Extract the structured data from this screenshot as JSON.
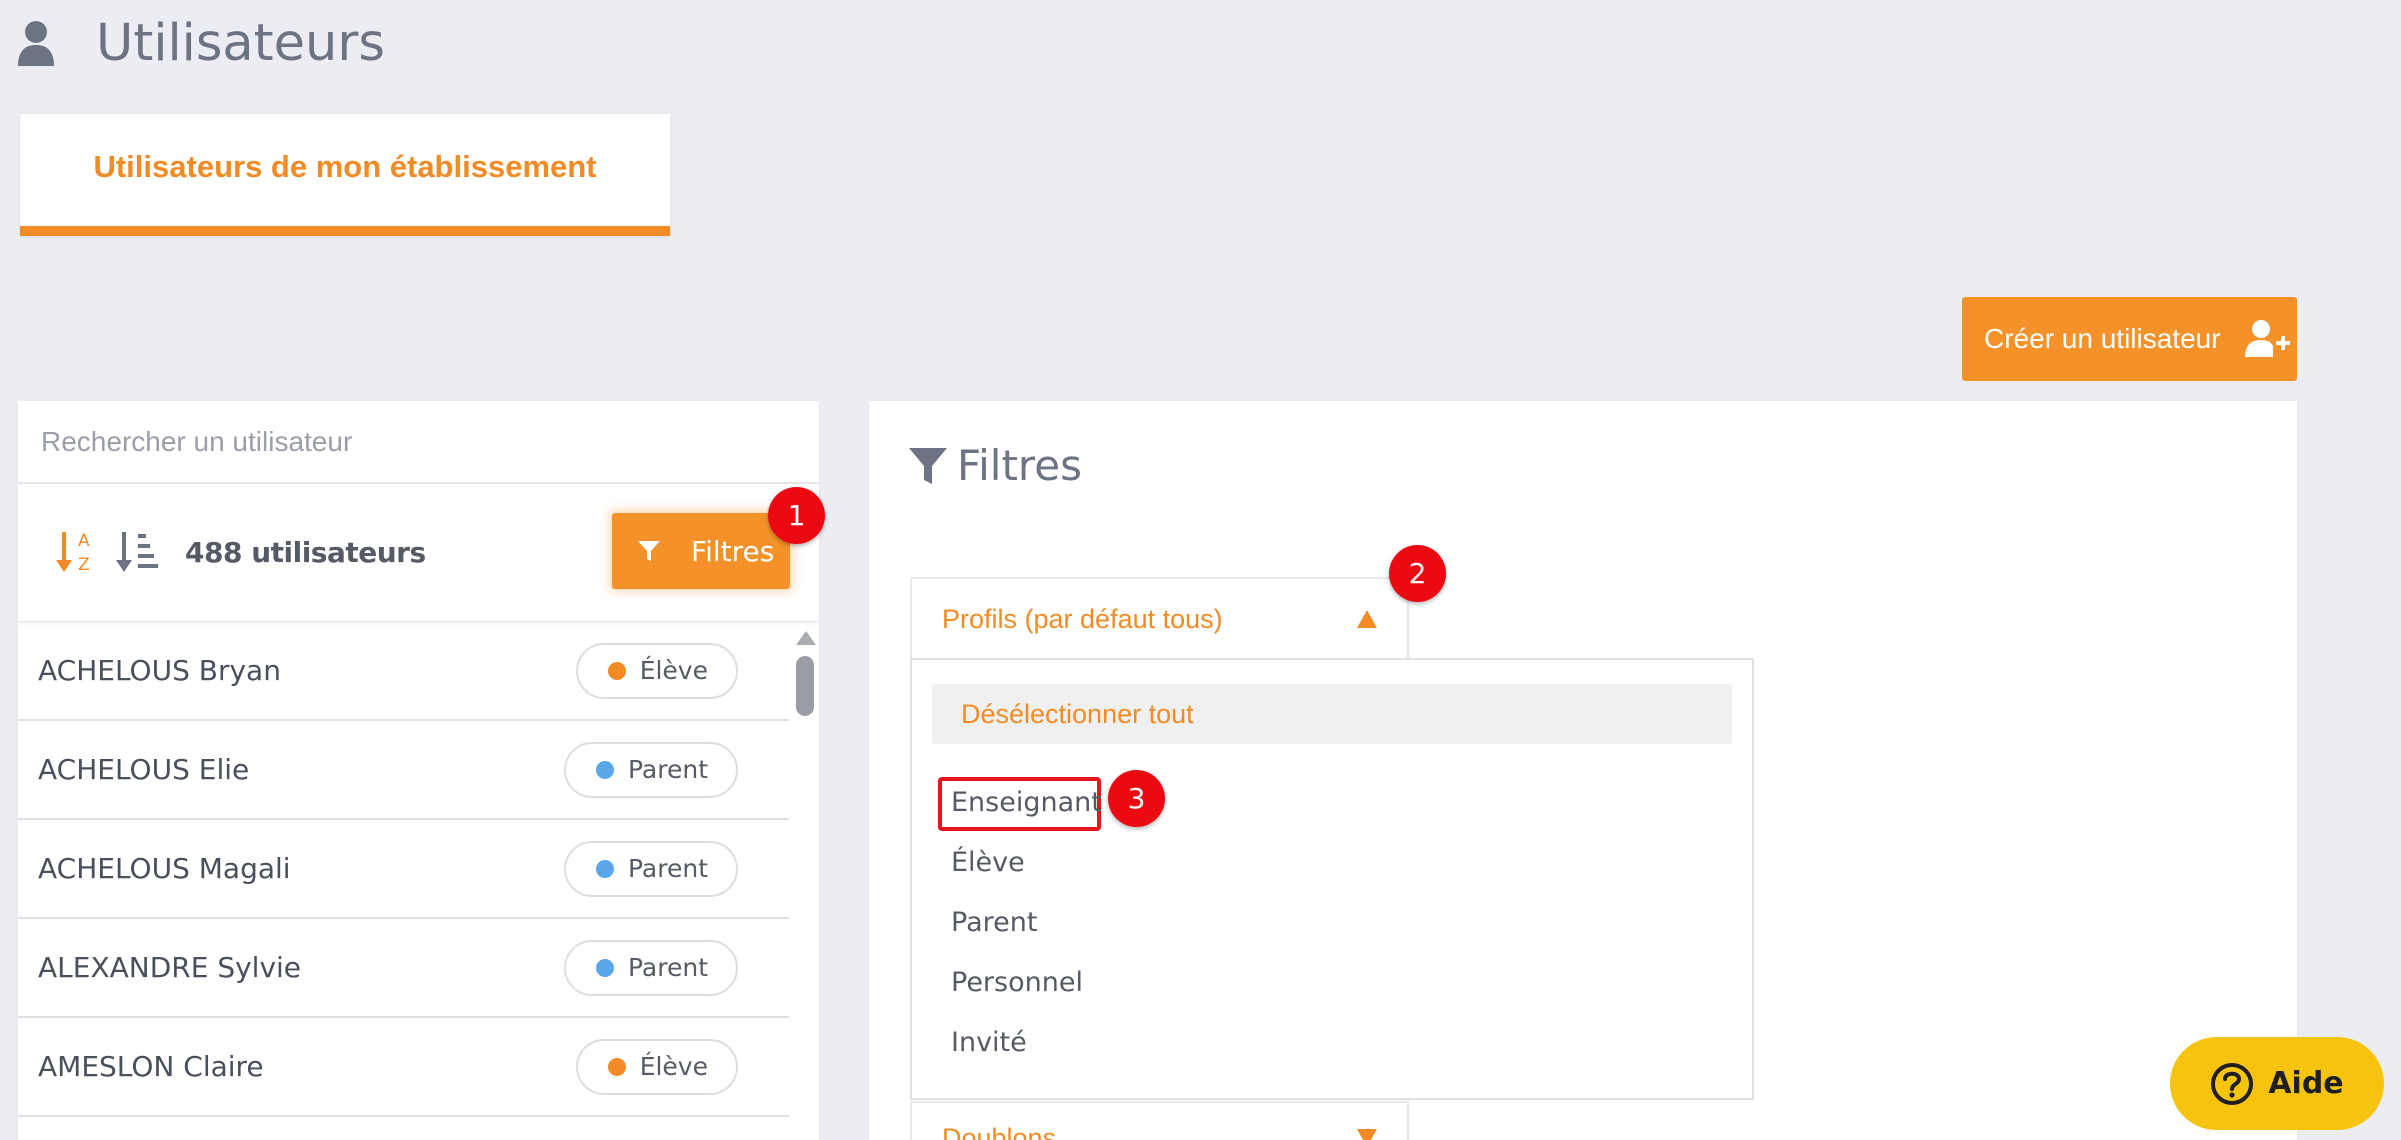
{
  "header": {
    "title": "Utilisateurs",
    "icon": "user-icon"
  },
  "tab": {
    "label": "Utilisateurs de mon établissement"
  },
  "create_button": {
    "label": "Créer un utilisateur",
    "icon": "add-user-icon"
  },
  "search": {
    "placeholder": "Rechercher un utilisateur",
    "value": ""
  },
  "toolbar": {
    "user_count": "488 utilisateurs",
    "filter_label": "Filtres"
  },
  "users": [
    {
      "name": "ACHELOUS Bryan",
      "role": "Élève",
      "color": "#f28b25"
    },
    {
      "name": "ACHELOUS Elie",
      "role": "Parent",
      "color": "#5aa6e8"
    },
    {
      "name": "ACHELOUS Magali",
      "role": "Parent",
      "color": "#5aa6e8"
    },
    {
      "name": "ALEXANDRE Sylvie",
      "role": "Parent",
      "color": "#5aa6e8"
    },
    {
      "name": "AMESLON Claire",
      "role": "Élève",
      "color": "#f28b25"
    }
  ],
  "filters": {
    "title": "Filtres",
    "profiles_header": "Profils (par défaut tous)",
    "deselect_all": "Désélectionner tout",
    "options": [
      "Enseignant",
      "Élève",
      "Parent",
      "Personnel",
      "Invité"
    ],
    "doublons_header": "Doublons"
  },
  "markers": [
    "1",
    "2",
    "3"
  ],
  "help": {
    "label": "Aide"
  },
  "colors": {
    "accent": "#f28b25",
    "marker": "#ec0a12",
    "help": "#f6c40e"
  }
}
